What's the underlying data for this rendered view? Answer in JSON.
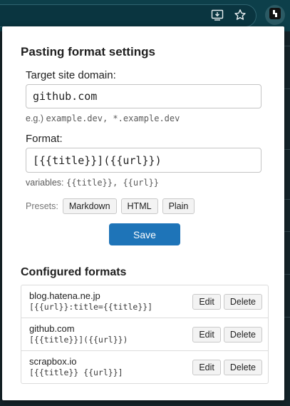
{
  "popup": {
    "title": "Pasting format settings",
    "domain_label": "Target site domain:",
    "domain_value": "github.com",
    "domain_hint_prefix": "e.g.) ",
    "domain_hint_examples": "example.dev, *.example.dev",
    "format_label": "Format:",
    "format_value": "[{{title}}]({{url}})",
    "format_hint_prefix": "variables: ",
    "format_hint_vars": "{{title}}, {{url}}",
    "presets_label": "Presets:",
    "presets": [
      "Markdown",
      "HTML",
      "Plain"
    ],
    "save_label": "Save",
    "configured_title": "Configured formats",
    "configured": [
      {
        "domain": "blog.hatena.ne.jp",
        "format": "[{{url}}:title={{title}}]"
      },
      {
        "domain": "github.com",
        "format": "[{{title}}]({{url}})"
      },
      {
        "domain": "scrapbox.io",
        "format": "[{{title}} {{url}}]"
      }
    ],
    "edit_label": "Edit",
    "delete_label": "Delete"
  },
  "browser": {
    "icons": [
      "install-app-icon",
      "bookmark-star-icon",
      "extension-icon"
    ],
    "toolbar_color": "#0d3f4a",
    "accent_color": "#1e74b8"
  }
}
